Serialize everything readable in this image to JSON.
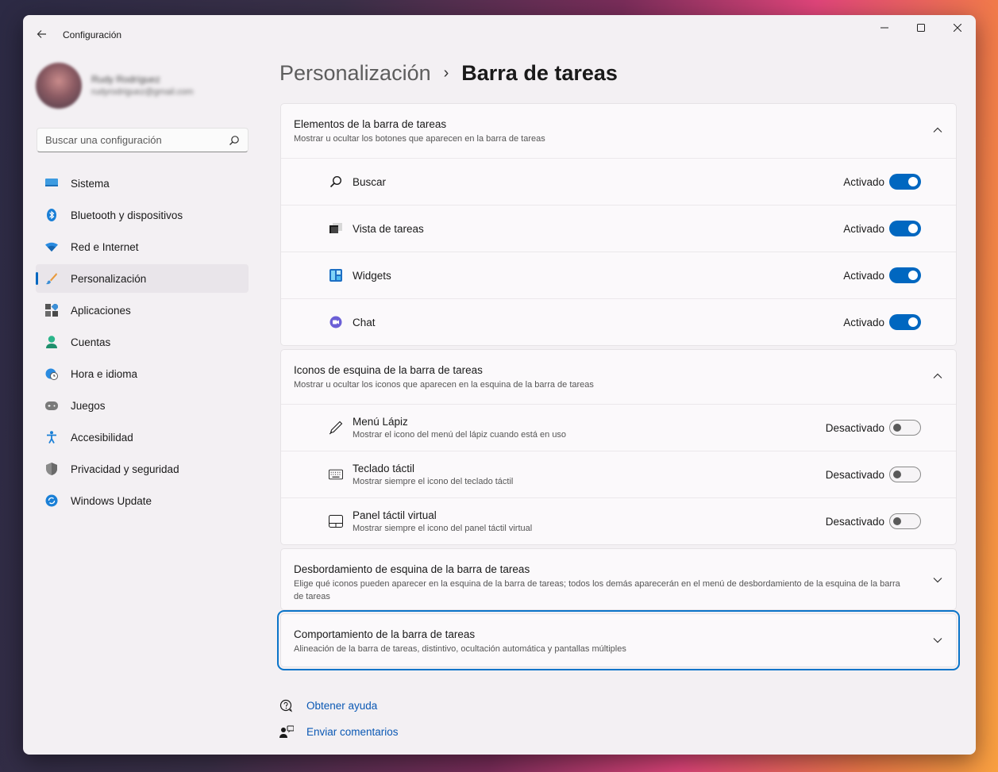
{
  "window": {
    "title": "Configuración"
  },
  "profile": {
    "name": "Rudy Rodríguez",
    "email": "rudyrodriguez@gmail.com"
  },
  "search": {
    "placeholder": "Buscar una configuración"
  },
  "sidebar": {
    "items": [
      {
        "label": "Sistema",
        "icon": "system-icon"
      },
      {
        "label": "Bluetooth y dispositivos",
        "icon": "bluetooth-icon"
      },
      {
        "label": "Red e Internet",
        "icon": "wifi-icon"
      },
      {
        "label": "Personalización",
        "icon": "brush-icon",
        "active": true
      },
      {
        "label": "Aplicaciones",
        "icon": "apps-icon"
      },
      {
        "label": "Cuentas",
        "icon": "account-icon"
      },
      {
        "label": "Hora e idioma",
        "icon": "globe-clock-icon"
      },
      {
        "label": "Juegos",
        "icon": "gamepad-icon"
      },
      {
        "label": "Accesibilidad",
        "icon": "accessibility-icon"
      },
      {
        "label": "Privacidad y seguridad",
        "icon": "shield-icon"
      },
      {
        "label": "Windows Update",
        "icon": "update-icon"
      }
    ]
  },
  "breadcrumb": {
    "parent": "Personalización",
    "separator": "›",
    "current": "Barra de tareas"
  },
  "groups": {
    "items": {
      "title": "Elementos de la barra de tareas",
      "subtitle": "Mostrar u ocultar los botones que aparecen en la barra de tareas",
      "rows": [
        {
          "title": "Buscar",
          "state": "Activado",
          "on": true,
          "icon": "search-icon"
        },
        {
          "title": "Vista de tareas",
          "state": "Activado",
          "on": true,
          "icon": "task-view-icon"
        },
        {
          "title": "Widgets",
          "state": "Activado",
          "on": true,
          "icon": "widgets-icon"
        },
        {
          "title": "Chat",
          "state": "Activado",
          "on": true,
          "icon": "chat-icon"
        }
      ]
    },
    "corner": {
      "title": "Iconos de esquina de la barra de tareas",
      "subtitle": "Mostrar u ocultar los iconos que aparecen en la esquina de la barra de tareas",
      "rows": [
        {
          "title": "Menú Lápiz",
          "subtitle": "Mostrar el icono del menú del lápiz cuando está en uso",
          "state": "Desactivado",
          "on": false,
          "icon": "pen-icon"
        },
        {
          "title": "Teclado táctil",
          "subtitle": "Mostrar siempre el icono del teclado táctil",
          "state": "Desactivado",
          "on": false,
          "icon": "keyboard-icon"
        },
        {
          "title": "Panel táctil virtual",
          "subtitle": "Mostrar siempre el icono del panel táctil virtual",
          "state": "Desactivado",
          "on": false,
          "icon": "touchpad-icon"
        }
      ]
    },
    "overflow": {
      "title": "Desbordamiento de esquina de la barra de tareas",
      "subtitle": "Elige qué iconos pueden aparecer en la esquina de la barra de tareas; todos los demás aparecerán en el menú de desbordamiento de la esquina de la barra de tareas"
    },
    "behavior": {
      "title": "Comportamiento de la barra de tareas",
      "subtitle": "Alineación de la barra de tareas, distintivo, ocultación automática y pantallas múltiples"
    }
  },
  "footer": {
    "help": "Obtener ayuda",
    "feedback": "Enviar comentarios"
  },
  "colors": {
    "accent": "#0067c0",
    "link": "#0a58b4",
    "focus": "#0a74c9"
  }
}
